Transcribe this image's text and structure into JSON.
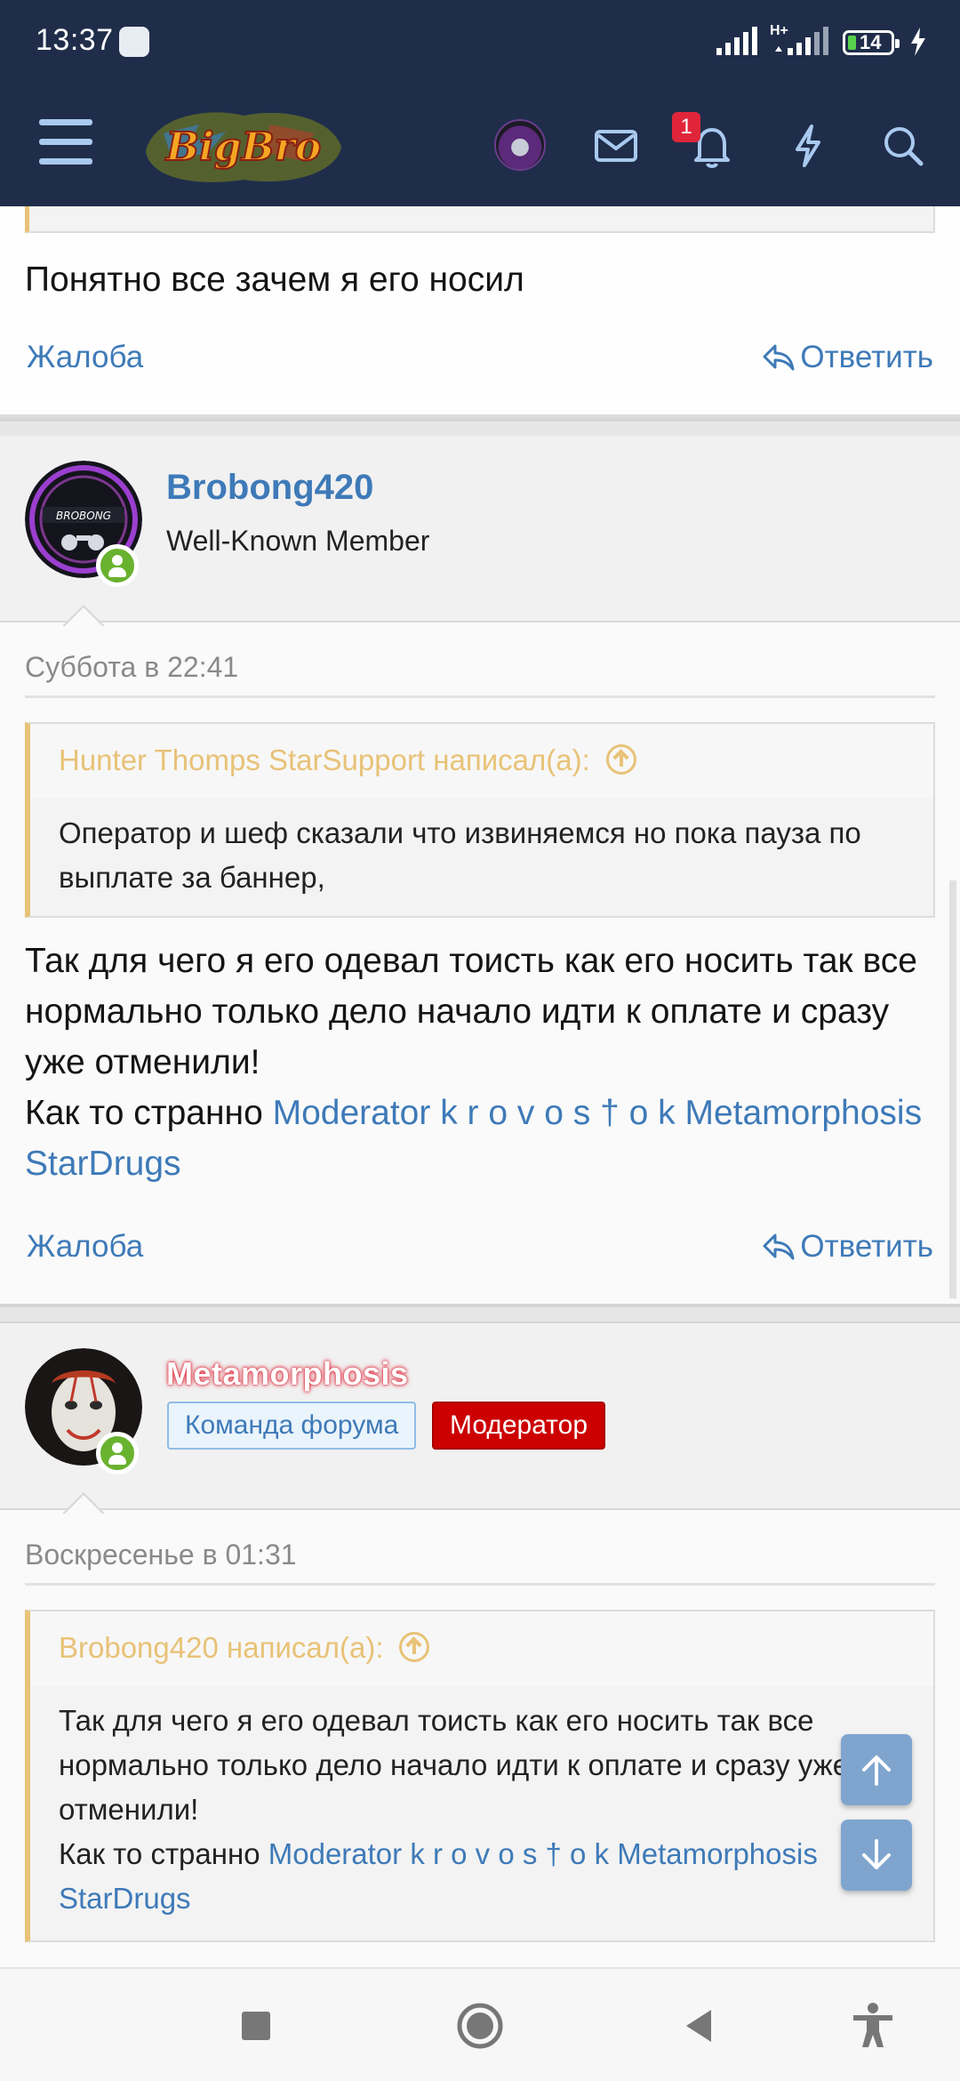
{
  "status_bar": {
    "time": "13:37",
    "network": "H+",
    "battery": "14"
  },
  "header": {
    "logo_text": "BigBro",
    "notification_count": "1"
  },
  "post_top": {
    "text": "Понятно все зачем я его носил",
    "report_label": "Жалоба",
    "reply_label": "Ответить"
  },
  "post1": {
    "username": "Brobong420",
    "user_title": "Well-Known Member",
    "date": "Суббота в 22:41",
    "quote_author": "Hunter Thomps StarSupport написал(а):",
    "quote_text": "Оператор и шеф сказали что извиняемся но пока пауза по выплате за баннер,",
    "body_line": "Так для чего я его одевал тоисть как его носить так все нормально только дело начало идти к оплате и сразу уже отменили!",
    "body_prefix": "Как то странно",
    "mention1": "Moderator k r o v o s † o k",
    "mention2": "Metamorphosis",
    "mention3": "StarDrugs",
    "report_label": "Жалоба",
    "reply_label": "Ответить"
  },
  "post2": {
    "username": "Metamorphosis",
    "badge_team": "Команда форума",
    "badge_mod": "Модератор",
    "date": "Воскресенье в 01:31",
    "quote_author": "Brobong420 написал(а):",
    "quote_text": "Так для чего я его одевал тоисть как его носить так все нормально только дело начало идти к оплате и сразу уже отменили!",
    "quote_prefix": "Как то странно",
    "mention1": "Moderator k r o v o s † o k",
    "mention2": "Metamorphosis",
    "mention3": "StarDrugs"
  },
  "colors": {
    "header_bg": "#1f2d4a",
    "link": "#3e7ab8",
    "quote_accent": "#e8c277",
    "moderator_red": "#cc0000",
    "online_green": "#69b22f"
  },
  "icons": [
    "menu-icon",
    "mail-icon",
    "bell-icon",
    "lightning-icon",
    "search-icon",
    "reply-icon",
    "scroll-up-icon",
    "scroll-down-icon",
    "recents-icon",
    "home-icon",
    "back-icon",
    "accessibility-icon"
  ]
}
